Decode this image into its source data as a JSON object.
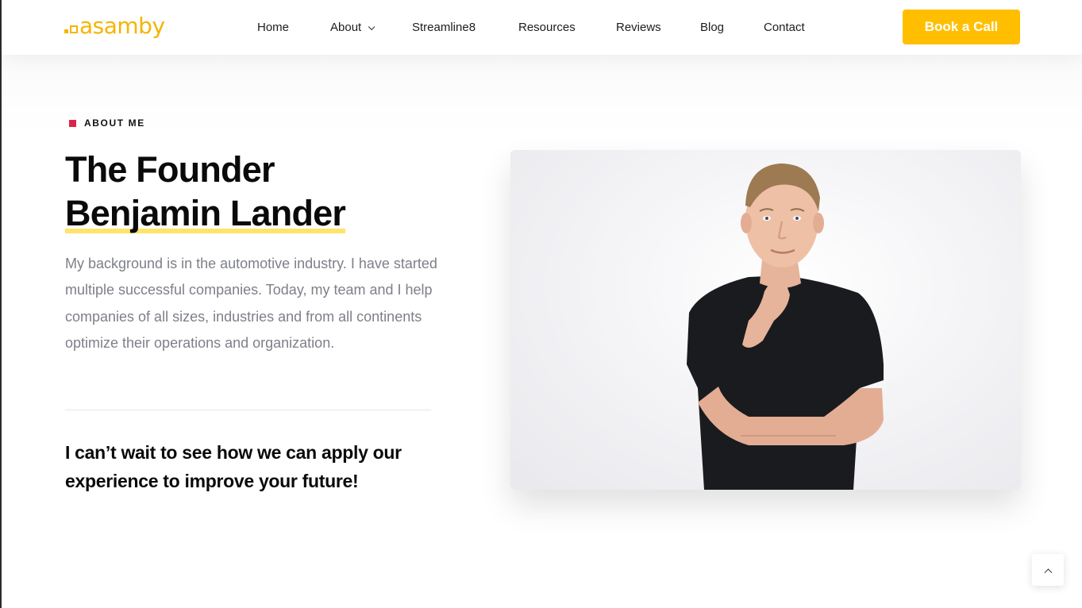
{
  "header": {
    "logo_text": "asamby",
    "nav": [
      {
        "label": "Home"
      },
      {
        "label": "About"
      },
      {
        "label": "Streamline8"
      },
      {
        "label": "Resources"
      },
      {
        "label": "Reviews"
      },
      {
        "label": "Blog"
      },
      {
        "label": "Contact"
      }
    ],
    "cta_label": "Book a Call"
  },
  "about": {
    "eyebrow": "ABOUT ME",
    "title_line1": "The Founder",
    "title_line2": "Benjamin Lander",
    "intro": "My background is in the automotive industry. I have started multiple successful companies. Today, my team and I help companies of all sizes, industries and from all continents optimize their operations and organization.",
    "quote": "I can’t wait to see how we can apply our experience to improve your future!"
  },
  "colors": {
    "brand": "#f6b400",
    "cta": "#ffbf00",
    "accent": "#d8264b",
    "highlight": "#ffe46b"
  },
  "icons": {
    "about_dropdown": "chevron-down-icon",
    "back_to_top": "chevron-up-icon"
  }
}
